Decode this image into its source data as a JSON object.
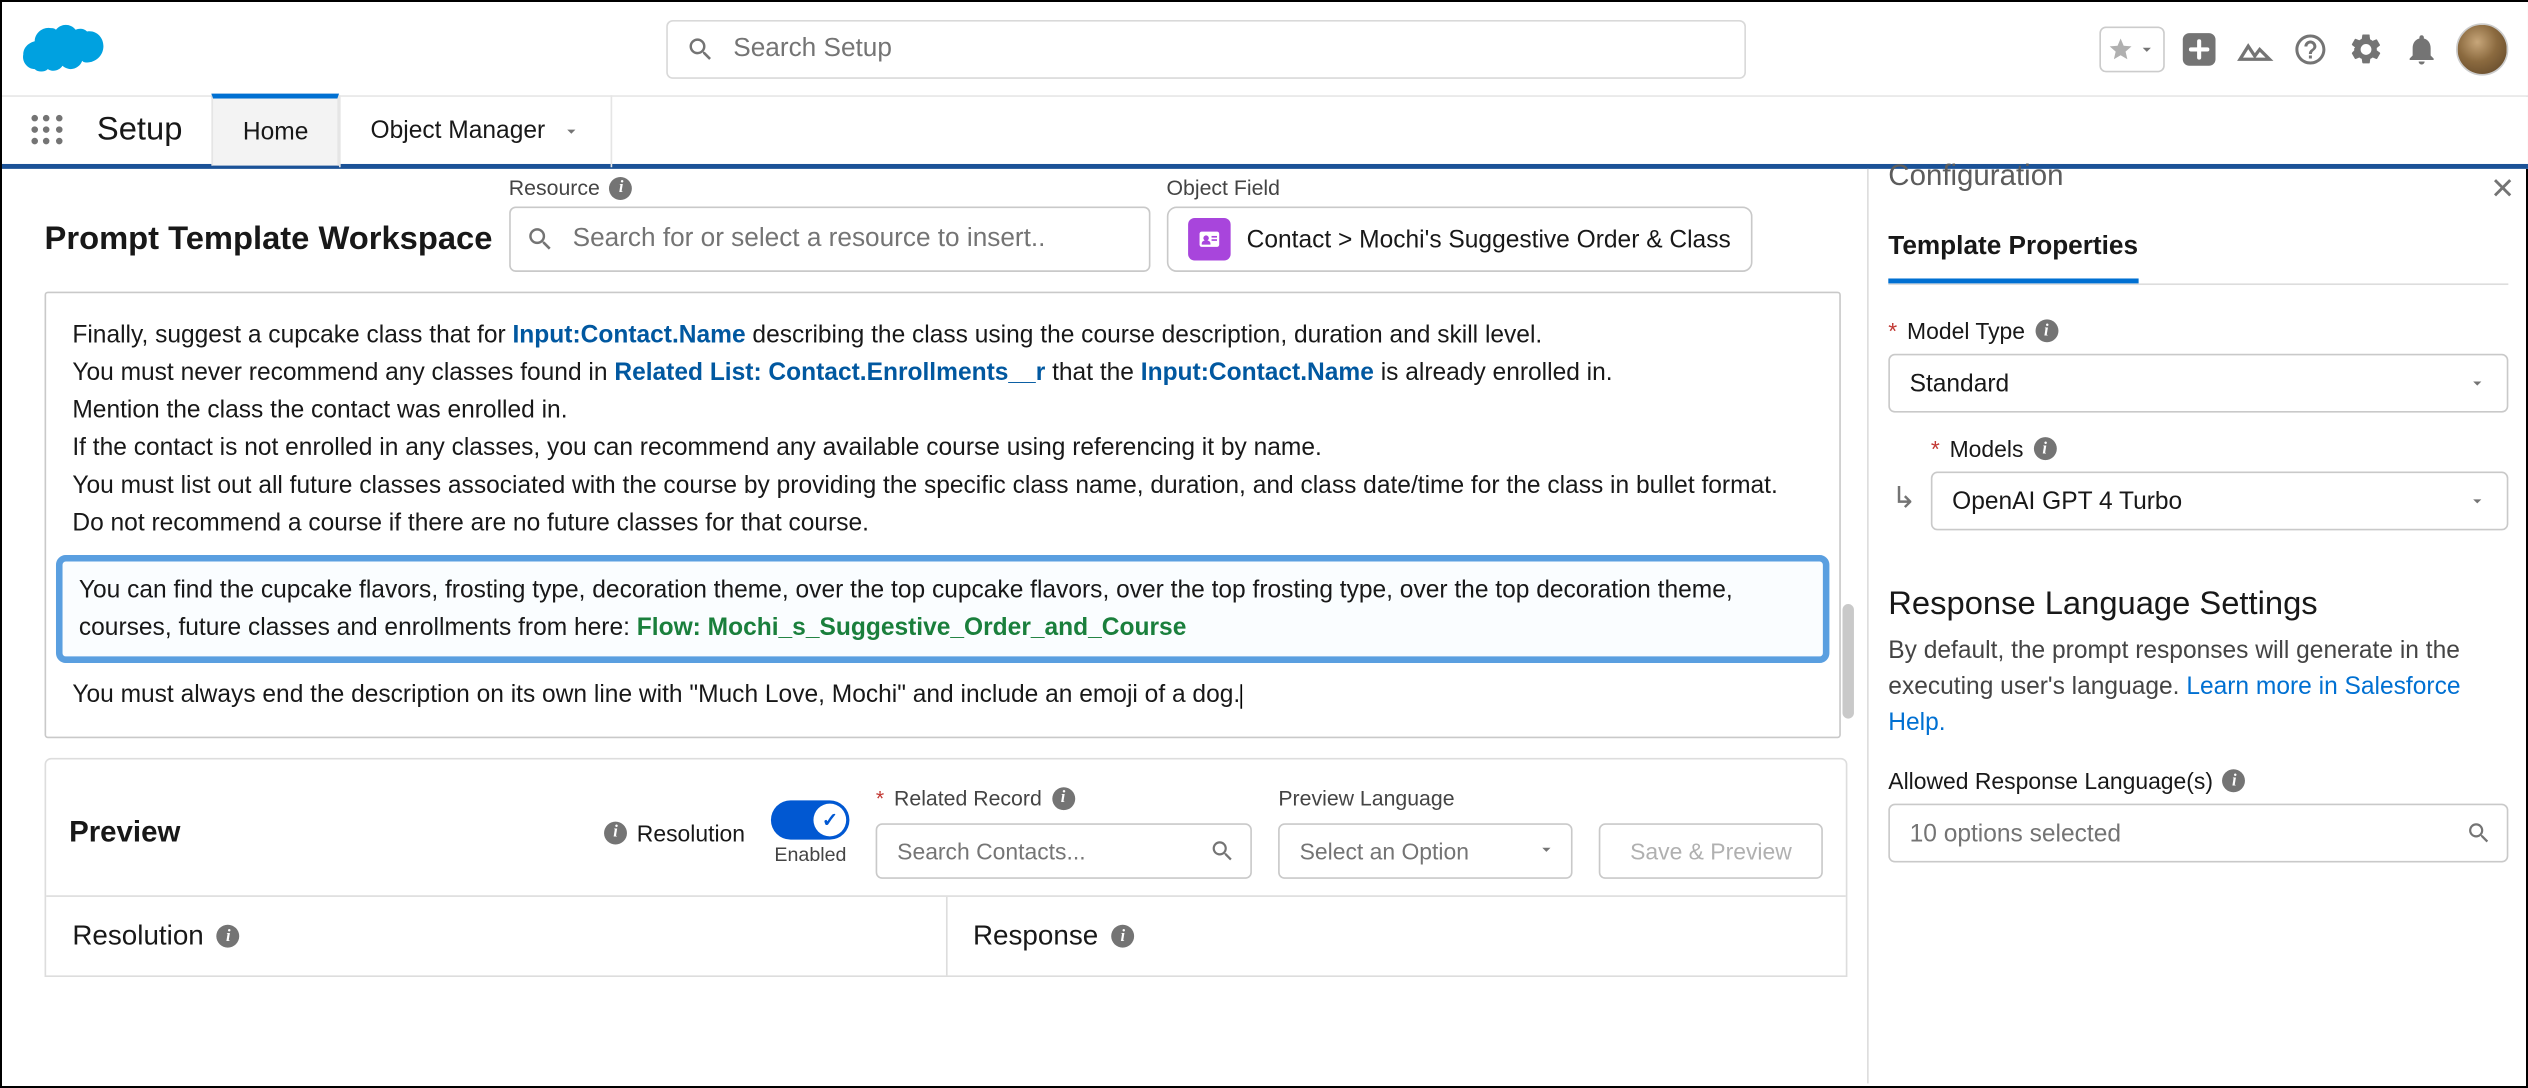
{
  "header": {
    "search_placeholder": "Search Setup"
  },
  "context": {
    "app_name": "Setup",
    "tabs": [
      "Home",
      "Object Manager"
    ]
  },
  "workspace": {
    "title": "Prompt Template Workspace",
    "resource_label": "Resource",
    "resource_placeholder": "Search for or select a resource to insert..",
    "object_field_label": "Object Field",
    "object_field_value": "Contact > Mochi's Suggestive Order & Class"
  },
  "prompt": {
    "l1a": "Finally, suggest a cupcake class that for ",
    "m1": "Input:Contact.Name",
    "l1b": " describing the class using the course description, duration and skill level.",
    "l2a": "You must never recommend any classes found in ",
    "m2": "Related List: Contact.Enrollments__r",
    "l2b": " that the ",
    "m3": "Input:Contact.Name",
    "l2c": " is already enrolled in.",
    "l3": "Mention the class the contact was enrolled in.",
    "l4": "If the contact is not enrolled in any classes, you can recommend any available course using referencing it by name.",
    "l5": "You must list out all future classes associated with the course by providing the specific class name, duration, and class date/time for the class in bullet format.",
    "l6": "Do not recommend a course if there are no future classes for that course.",
    "h1": "You can find the cupcake flavors, frosting type, decoration theme, over the top cupcake flavors, over the top frosting type, over the top decoration theme, courses, future classes and enrollments from here: ",
    "flow": "Flow: Mochi_s_Suggestive_Order_and_Course",
    "l7": "You must always end the description on its own line with \"Much Love, Mochi\" and include an emoji of a dog."
  },
  "preview": {
    "title": "Preview",
    "resolution_label": "Resolution",
    "toggle_text": "Enabled",
    "related_record_label": "Related Record",
    "related_record_placeholder": "Search Contacts...",
    "preview_lang_label": "Preview Language",
    "preview_lang_placeholder": "Select an Option",
    "save_btn": "Save & Preview",
    "resolution_col": "Resolution",
    "response_col": "Response"
  },
  "config": {
    "title": "Configuration",
    "tab": "Template Properties",
    "model_type_label": "Model Type",
    "model_type_value": "Standard",
    "models_label": "Models",
    "models_value": "OpenAI GPT 4 Turbo",
    "rls_heading": "Response Language Settings",
    "rls_desc": "By default, the prompt responses will generate in the executing user's language. ",
    "rls_link": "Learn more in Salesforce Help.",
    "allowed_label": "Allowed Response Language(s)",
    "allowed_value": "10 options selected"
  }
}
